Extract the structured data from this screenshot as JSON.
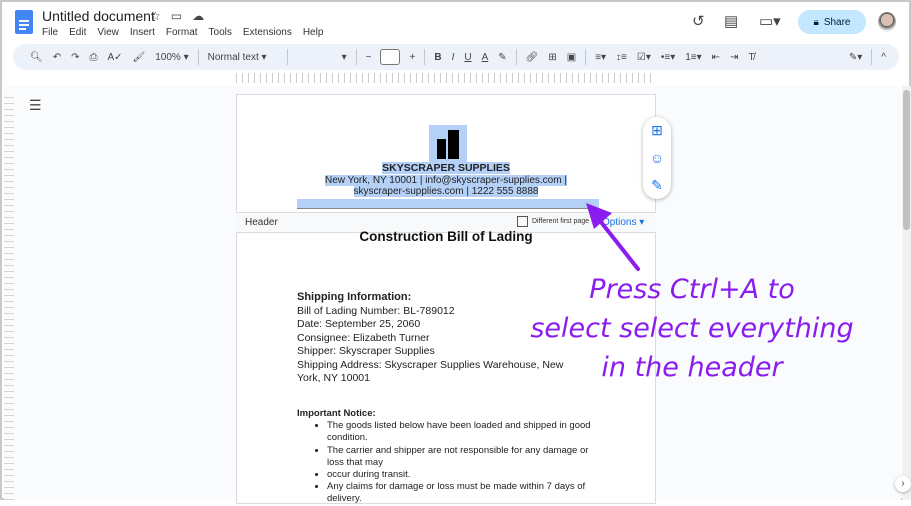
{
  "app": {
    "title": "Untitled document",
    "menu": [
      "File",
      "Edit",
      "View",
      "Insert",
      "Format",
      "Tools",
      "Extensions",
      "Help"
    ],
    "share_label": "Share"
  },
  "toolbar": {
    "zoom": "100%",
    "style": "Normal text",
    "font": "",
    "font_size": ""
  },
  "header_content": {
    "company": "SKYSCRAPER SUPPLIES",
    "line1": "New York, NY 10001 | info@skyscraper-supplies.com |",
    "line2": "skyscraper-supplies.com | 1222 555 8888"
  },
  "header_bar": {
    "label": "Header",
    "checkbox_label": "Different first page",
    "options": "Options"
  },
  "document": {
    "title": "Construction Bill of Lading",
    "shipping_heading": "Shipping Information:",
    "shipping_lines": [
      "Bill of Lading Number: BL-789012",
      "Date: September 25, 2060",
      "Consignee: Elizabeth Turner",
      "Shipper: Skyscraper Supplies",
      "Shipping Address: Skyscraper Supplies Warehouse, New York, NY 10001"
    ],
    "notice_heading": "Important Notice:",
    "notice_items": [
      "The goods listed below have been loaded and shipped in good condition.",
      "The carrier and shipper are not responsible for any damage or loss that may",
      "occur during transit.",
      "Any claims for damage or loss must be made within 7 days of delivery."
    ]
  },
  "annotation": {
    "lines": [
      "Press Ctrl+A to",
      "select select everything",
      "in the header"
    ],
    "color": "#8a1cf0"
  }
}
